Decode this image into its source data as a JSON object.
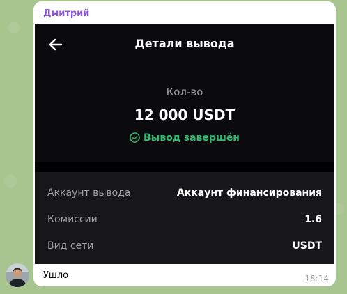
{
  "message": {
    "sender": "Дмитрий",
    "caption": "Ушло",
    "time": "18:14",
    "sender_color": "#8b55d9"
  },
  "screen": {
    "title": "Детали вывода",
    "back_icon": "arrow-left-icon",
    "amount_label": "Кол-во",
    "amount_value": "12 000 USDT",
    "status_text": "Вывод завершён",
    "status_icon": "check-circle-icon",
    "status_color": "#2ebd72",
    "details": [
      {
        "label": "Аккаунт вывода",
        "value": "Аккаунт финансирования"
      },
      {
        "label": "Комиссии",
        "value": "1.6"
      },
      {
        "label": "Вид сети",
        "value": "USDT"
      }
    ]
  }
}
